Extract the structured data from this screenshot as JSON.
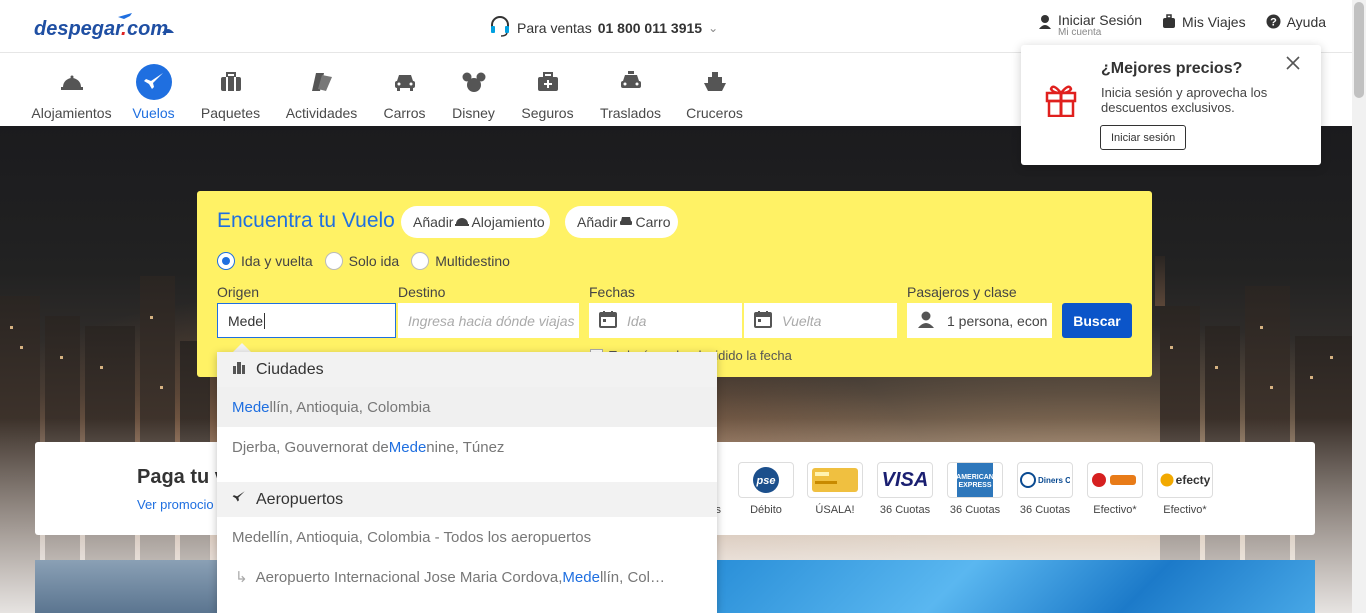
{
  "header": {
    "logo": "despegar.com",
    "sales_prefix": "Para ventas",
    "sales_phone": "01 800 011 3915",
    "login_label": "Iniciar Sesión",
    "login_sub": "Mi cuenta",
    "trips_label": "Mis Viajes",
    "help_label": "Ayuda"
  },
  "nav": {
    "items": [
      {
        "label": "Alojamientos",
        "icon": "hotel-bell-icon"
      },
      {
        "label": "Vuelos",
        "icon": "airplane-icon",
        "active": true
      },
      {
        "label": "Paquetes",
        "icon": "suitcase-icon"
      },
      {
        "label": "Actividades",
        "icon": "tickets-icon"
      },
      {
        "label": "Carros",
        "icon": "car-icon"
      },
      {
        "label": "Disney",
        "icon": "mickey-icon"
      },
      {
        "label": "Seguros",
        "icon": "insurance-bag-icon"
      },
      {
        "label": "Traslados",
        "icon": "taxi-icon"
      },
      {
        "label": "Cruceros",
        "icon": "ship-icon"
      }
    ]
  },
  "search": {
    "title": "Encuentra tu Vuelo",
    "add_lodging": "Añadir",
    "add_lodging_suffix": "Alojamiento",
    "add_car": "Añadir",
    "add_car_suffix": "Carro",
    "trip_types": [
      "Ida y vuelta",
      "Solo ida",
      "Multidestino"
    ],
    "origin_label": "Origen",
    "origin_value": "Mede",
    "destination_label": "Destino",
    "destination_placeholder": "Ingresa hacia dónde viajas",
    "dates_label": "Fechas",
    "depart_placeholder": "Ida",
    "return_placeholder": "Vuelta",
    "pax_label": "Pasajeros y clase",
    "pax_value": "1 persona, econ",
    "search_button": "Buscar",
    "undecided_dates": "Todavía no he decidido la fecha"
  },
  "autocomplete": {
    "cities_header": "Ciudades",
    "cities": [
      {
        "match": "Mede",
        "rest": "llín, Antioquia, Colombia",
        "pre": ""
      },
      {
        "pre": "Djerba, Gouvernorat de ",
        "match": "Mede",
        "rest": "nine, Túnez"
      }
    ],
    "airports_header": "Aeropuertos",
    "airport_all": "Medellín, Antioquia, Colombia - Todos los aeropuertos",
    "airport_item_pre": "Aeropuerto Internacional Jose Maria Cordova, ",
    "airport_item_match": "Mede",
    "airport_item_rest": "llín, Col…"
  },
  "payments": {
    "title": "Paga tu v",
    "link": "Ver promocio",
    "methods": [
      {
        "name": "pse",
        "caption": "Débito"
      },
      {
        "name": "usala",
        "caption": "ÚSALA!"
      },
      {
        "name": "VISA",
        "caption": "36 Cuotas"
      },
      {
        "name": "AMERICAN EXPRESS",
        "caption": "36 Cuotas"
      },
      {
        "name": "Diners Club",
        "caption": "36 Cuotas"
      },
      {
        "name": "baloto",
        "caption": "Efectivo*"
      },
      {
        "name": "efecty",
        "caption": "Efectivo*"
      }
    ],
    "partial_caption": "s"
  },
  "popover": {
    "title": "¿Mejores precios?",
    "text": "Inicia sesión y aprovecha los descuentos exclusivos.",
    "button": "Iniciar sesión"
  },
  "colors": {
    "brand_blue": "#1f6fe0",
    "search_yellow": "#fff265",
    "buscar_blue": "#0b55c9"
  }
}
